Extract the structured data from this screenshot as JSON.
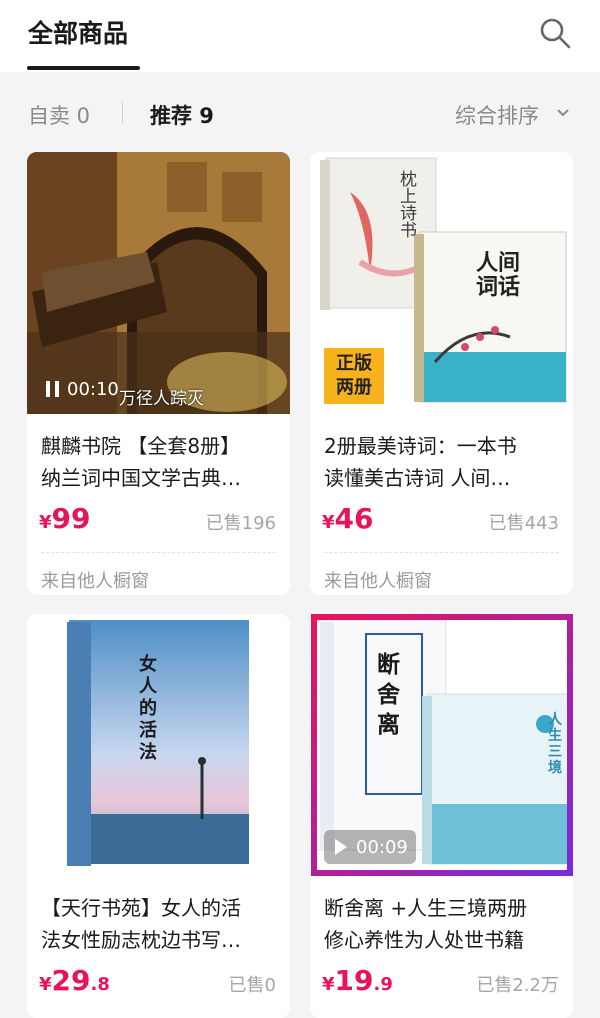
{
  "header": {
    "title": "全部商品",
    "search_icon": "search-icon"
  },
  "filters": {
    "self_label": "自卖 0",
    "recommend_label": "推荐 9",
    "sort_label": "综合排序",
    "sort_icon": "chevron-down-icon"
  },
  "products": [
    {
      "title_line1": "麒麟书院 【全套8册】",
      "title_line2": "纳兰词中国文学古典…",
      "price_currency": "¥",
      "price_int": "99",
      "price_dec": "",
      "sold": "已售196",
      "source": "来自他人橱窗",
      "video_time": "00:10",
      "caption": "万径人踪灭"
    },
    {
      "title_line1": "2册最美诗词：一本书",
      "title_line2": "读懂美古诗词 人间…",
      "price_currency": "¥",
      "price_int": "46",
      "price_dec": "",
      "sold": "已售443",
      "source": "来自他人橱窗",
      "book1_title": "枕上诗书",
      "book2_title": "人间词话",
      "stamp_line1": "正版",
      "stamp_line2": "两册"
    },
    {
      "title_line1": "【天行书苑】女人的活",
      "title_line2": "法女性励志枕边书写…",
      "price_currency": "¥",
      "price_int": "29",
      "price_dec": ".8",
      "sold": "已售0",
      "book_title": "女人的活法"
    },
    {
      "title_line1": "断舍离 +人生三境两册",
      "title_line2": "修心养性为人处世书籍",
      "price_currency": "¥",
      "price_int": "19",
      "price_dec": ".9",
      "sold": "已售2.2万",
      "video_time": "00:09",
      "book1_title": "断舍离",
      "book2_title": "人生三境"
    }
  ],
  "colors": {
    "price": "#e8145a",
    "highlight_start": "#e8145a",
    "highlight_end": "#7a2bd9"
  }
}
